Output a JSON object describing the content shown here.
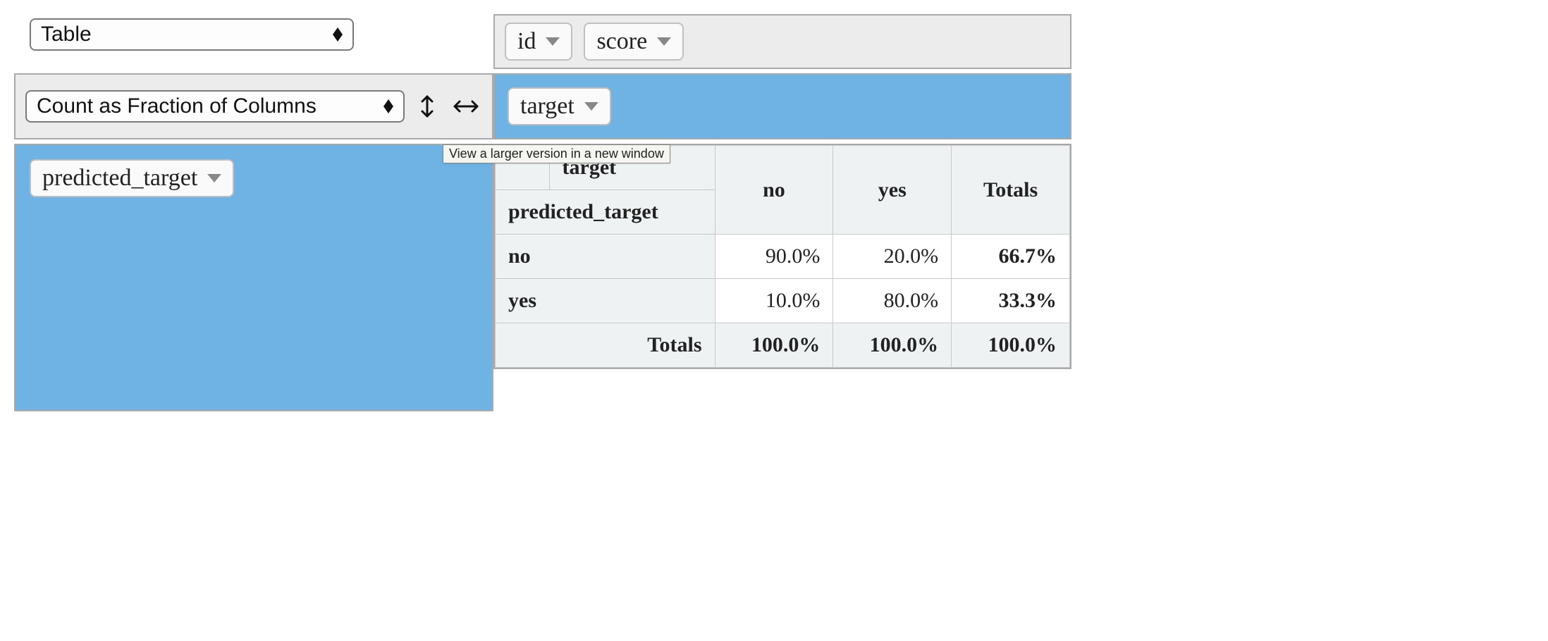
{
  "renderer_select": "Table",
  "aggregator_select": "Count as Fraction of Columns",
  "unused_fields": [
    "id",
    "score"
  ],
  "column_field": "target",
  "row_field": "predicted_target",
  "tooltip": "View a larger version in a new window",
  "table": {
    "col_label": "target",
    "row_label": "predicted_target",
    "columns": [
      "no",
      "yes"
    ],
    "totals_label": "Totals",
    "rows": [
      {
        "label": "no",
        "values": [
          "90.0%",
          "20.0%"
        ],
        "total": "66.7%"
      },
      {
        "label": "yes",
        "values": [
          "10.0%",
          "80.0%"
        ],
        "total": "33.3%"
      }
    ],
    "col_totals": [
      "100.0%",
      "100.0%"
    ],
    "grand_total": "100.0%"
  }
}
